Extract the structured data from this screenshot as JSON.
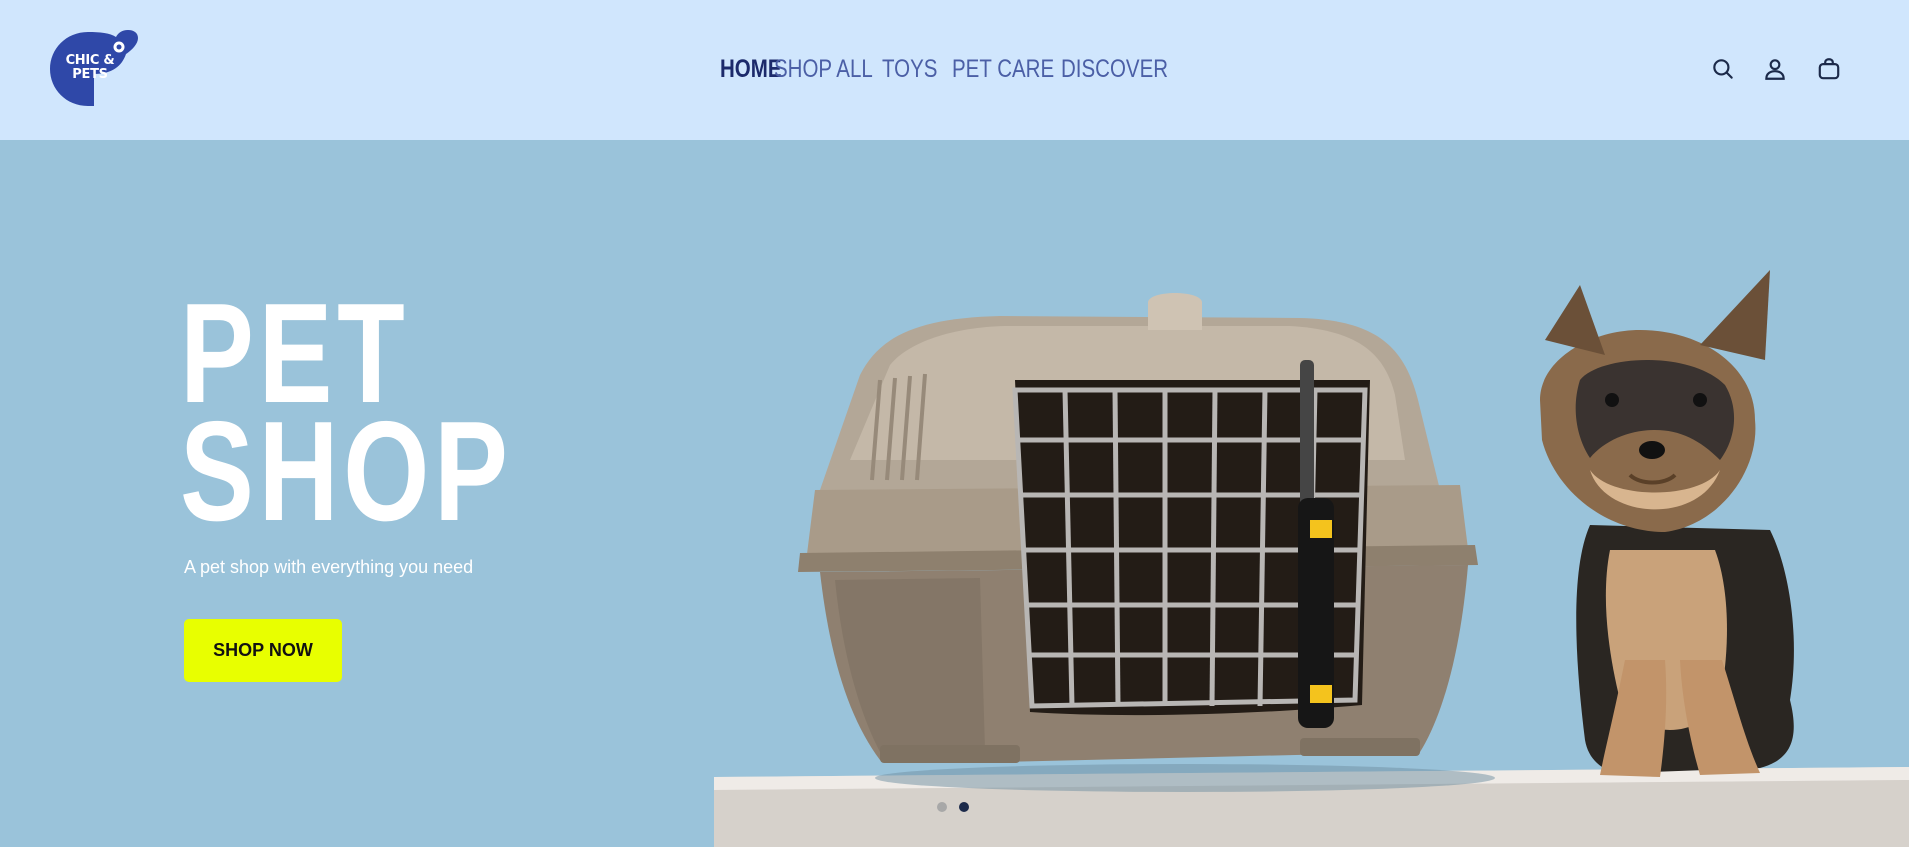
{
  "brand": {
    "logo_text_line1": "CHIC &",
    "logo_text_line2": "PETS",
    "logo_color": "#2f48a8"
  },
  "nav": {
    "items": [
      {
        "label": "HOME",
        "active": true
      },
      {
        "label": "SHOP ALL",
        "active": false
      },
      {
        "label": "TOYS",
        "active": false
      },
      {
        "label": "PET CARE",
        "active": false
      },
      {
        "label": "DISCOVER",
        "active": false
      }
    ]
  },
  "header_icons": [
    "search-icon",
    "account-icon",
    "cart-icon"
  ],
  "hero": {
    "title_line1": "PET",
    "title_line2": "SHOP",
    "subtitle": "A pet shop with everything you need",
    "cta_label": "SHOP NOW",
    "cta_color": "#e8ff00",
    "background_color": "#9ac3da",
    "slides": [
      {
        "active": false
      },
      {
        "active": true
      }
    ]
  },
  "colors": {
    "header_bg": "#d0e6fd",
    "nav_active": "#1c2a6b",
    "nav_default": "#4b5fa6"
  }
}
